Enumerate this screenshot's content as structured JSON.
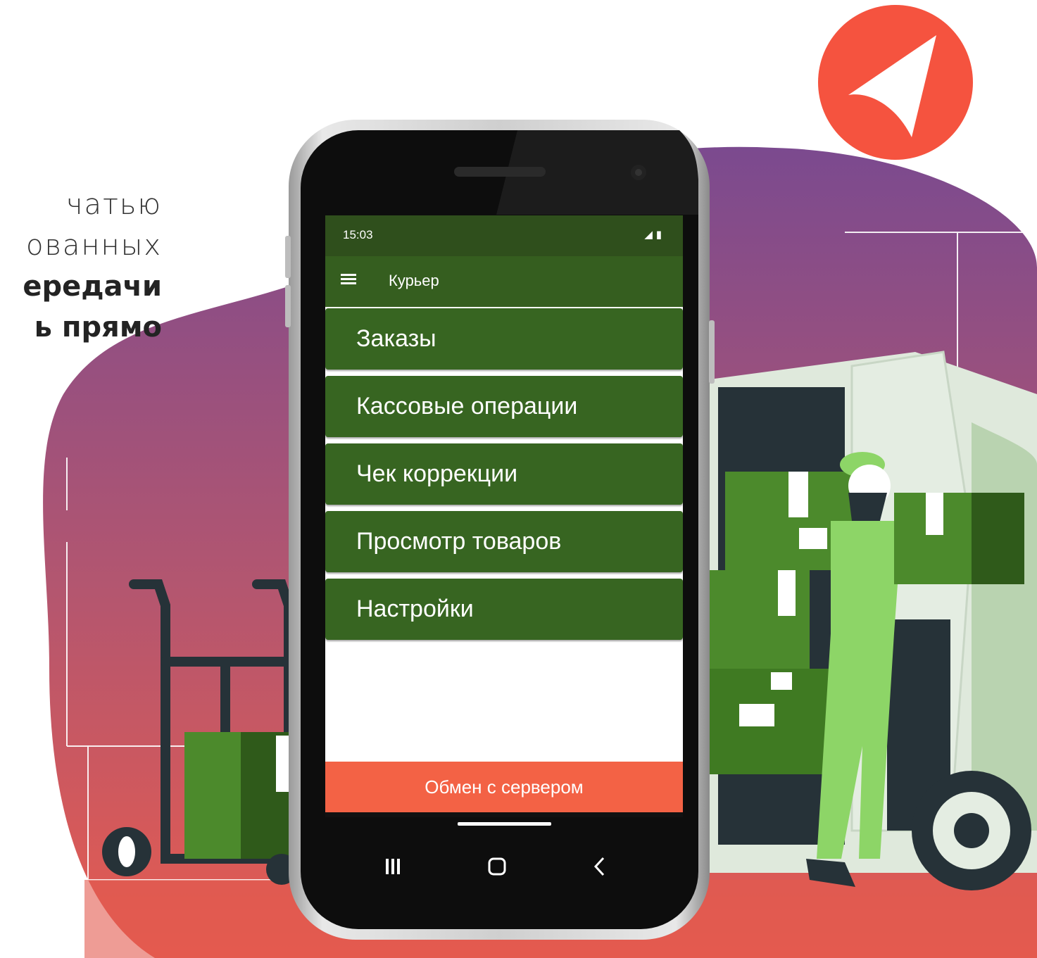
{
  "promo": {
    "line1": "чатью",
    "line2": "ованных",
    "line3": "ередачи",
    "line4": "ь прямо"
  },
  "status_bar": {
    "time": "15:03"
  },
  "app_bar": {
    "title": "Курьер"
  },
  "menu": {
    "items": [
      {
        "label": "Заказы"
      },
      {
        "label": "Кассовые операции"
      },
      {
        "label": "Чек коррекции"
      },
      {
        "label": "Просмотр товаров"
      },
      {
        "label": "Настройки"
      }
    ]
  },
  "footer": {
    "exchange_label": "Обмен с сервером"
  },
  "colors": {
    "status_bar": "#2f4f1c",
    "app_bar": "#355e1f",
    "menu_item": "#376521",
    "exchange_button": "#f36245",
    "logo": "#f5533f"
  },
  "icons": [
    "menu-icon",
    "send-arrow-logo-icon",
    "signal-icon",
    "battery-icon",
    "recent-apps-icon",
    "home-icon",
    "back-icon"
  ]
}
